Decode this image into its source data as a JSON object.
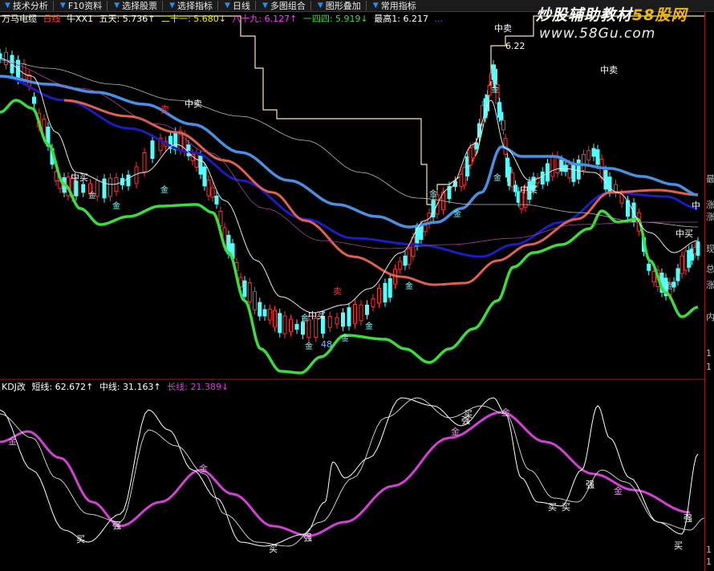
{
  "toolbar": {
    "items": [
      {
        "label": "技术分析",
        "icon": "dropdown-arrow-icon"
      },
      {
        "label": "F10资料",
        "icon": "dropdown-arrow-icon"
      },
      {
        "label": "选择股票",
        "icon": "dropdown-arrow-icon"
      },
      {
        "label": "选择指标",
        "icon": "dropdown-arrow-icon"
      },
      {
        "label": "日线",
        "icon": "dropdown-arrow-icon"
      },
      {
        "label": "多图组合",
        "icon": "dropdown-arrow-icon"
      },
      {
        "label": "图形叠加",
        "icon": "dropdown-arrow-icon"
      },
      {
        "label": "常用指标",
        "icon": "dropdown-arrow-icon"
      }
    ]
  },
  "watermark": {
    "title": "炒股辅助教材",
    "site": "58股网",
    "url": "www.58Gu.com"
  },
  "upper_legend": {
    "stock": "万马电缆",
    "period": "日线",
    "indicator": "牛XX1",
    "ma5": "五天: 5.736↑",
    "ma21": "二十一: 5.680↓",
    "ma89": "八十九: 6.127↑",
    "ma144": "一四四: 5.919↓",
    "high": "最高1: 6.217",
    "extra": "..."
  },
  "lower_legend": {
    "name": "KDJ改",
    "short": "短线: 62.672↑",
    "mid": "中线: 31.163↑",
    "long": "长线: 21.389↓"
  },
  "colors": {
    "up": "#ff3232",
    "down": "#54ffff",
    "green_band": "#3bdc3b",
    "blue_line": "#4a90e2",
    "red_line": "#e0624c",
    "magenta": "#d63fd6",
    "envelope": "#f6e9a8",
    "navy": "#1c1cc4",
    "border_red": "#9a1d1d"
  },
  "annotations": {
    "sell": "卖",
    "buy": "买",
    "strong": "强",
    "gold": "金",
    "mid_sell": "中卖",
    "mid_buy": "中买",
    "mid": "中",
    "price_high": "6.22",
    "num_48": "48"
  },
  "right_axis": {
    "labels": [
      "最",
      "涨",
      "涨",
      "现",
      "总",
      "涨",
      "内",
      "1",
      "1",
      "1",
      "1"
    ]
  }
}
